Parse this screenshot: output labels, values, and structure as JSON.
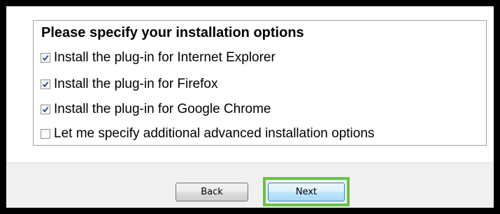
{
  "installer": {
    "options_title": "Please specify your installation options",
    "options": [
      {
        "label": "Install the plug-in for Internet Explorer",
        "checked": true
      },
      {
        "label": "Install the plug-in for Firefox",
        "checked": true
      },
      {
        "label": "Install the plug-in for Google Chrome",
        "checked": true
      },
      {
        "label": "Let me specify additional advanced installation options",
        "checked": false
      }
    ],
    "back_label": "Back",
    "next_label": "Next"
  },
  "colors": {
    "highlight": "#6cc04a",
    "check": "#2a4f8c"
  }
}
